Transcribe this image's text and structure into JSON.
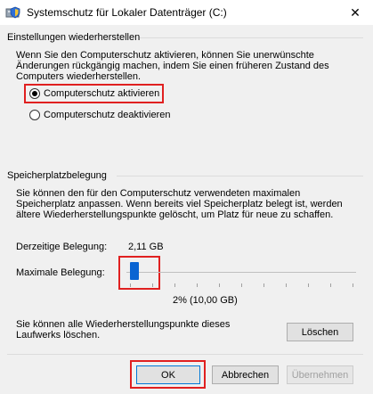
{
  "window": {
    "title": "Systemschutz für Lokaler Datenträger (C:)",
    "close_symbol": "✕",
    "title_icon": "drive-shield-icon"
  },
  "restore": {
    "group_label": "Einstellungen wiederherstellen",
    "description": "Wenn Sie den Computerschutz aktivieren, können Sie unerwünschte Änderungen rückgängig machen, indem Sie einen früheren Zustand des Computers wiederherstellen.",
    "options": [
      {
        "label": "Computerschutz aktivieren",
        "checked": true
      },
      {
        "label": "Computerschutz deaktivieren",
        "checked": false
      }
    ]
  },
  "storage": {
    "group_label": "Speicherplatzbelegung",
    "description": "Sie können den für den Computerschutz verwendeten maximalen Speicherplatz anpassen. Wenn bereits viel Speicherplatz belegt ist, werden ältere Wiederherstellungspunkte gelöscht, um Platz für neue zu schaffen.",
    "current_label": "Derzeitige Belegung:",
    "current_value": "2,11 GB",
    "max_label": "Maximale Belegung:",
    "slider_percent": 2,
    "slider_readout": "2% (10,00 GB)",
    "delete_text": "Sie können alle Wiederherstellungspunkte dieses Laufwerks löschen.",
    "delete_button": "Löschen"
  },
  "footer": {
    "ok": "OK",
    "cancel": "Abbrechen",
    "apply": "Übernehmen"
  },
  "colors": {
    "highlight": "#e02020",
    "slider_thumb": "#0a64d2"
  }
}
